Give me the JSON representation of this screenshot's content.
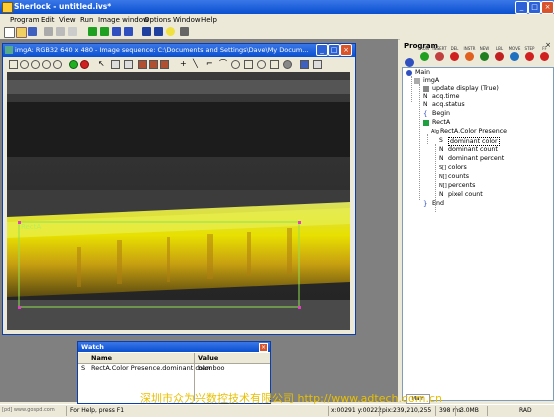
{
  "app": {
    "title": "Sherlock - untitled.ivs*"
  },
  "menu": [
    "Program",
    "Edit",
    "View",
    "Run",
    "Image window",
    "Options",
    "Window",
    "Help"
  ],
  "image_window": {
    "title": "imgA: RGB32 640 x 480 - Image sequence: C:\\Documents and Settings\\Dave\\My Docum...",
    "roi_label": "RectA"
  },
  "watch": {
    "title": "Watch",
    "columns": [
      "Name",
      "Value"
    ],
    "rows": [
      {
        "type": "S",
        "name": "RectA.Color Presence.dominant color",
        "value": "bamboo"
      }
    ]
  },
  "program_panel": {
    "title": "Program",
    "tools": [
      "",
      "RUN",
      "INSERT",
      "DEL",
      "INSTR",
      "NEW",
      "LBL",
      "MOVE",
      "STEP",
      "FF"
    ],
    "tree": [
      {
        "label": "Main",
        "level": 0,
        "icon": "main-icon"
      },
      {
        "label": "imgA",
        "level": 1,
        "icon": "image-icon"
      },
      {
        "label": "update display (True)",
        "level": 2,
        "icon": "instruction-icon"
      },
      {
        "label": "acq.time",
        "level": 2,
        "icon": "numeric-var-icon"
      },
      {
        "label": "acq.status",
        "level": 2,
        "icon": "numeric-var-icon"
      },
      {
        "label": "Begin",
        "level": 2,
        "icon": "begin-icon"
      },
      {
        "label": "RectA",
        "level": 2,
        "icon": "rect-roi-icon"
      },
      {
        "label": "RectA.Color Presence",
        "level": 3,
        "icon": "algorithm-icon"
      },
      {
        "label": "dominant color",
        "level": 4,
        "icon": "string-var-icon",
        "selected": true
      },
      {
        "label": "dominant count",
        "level": 4,
        "icon": "numeric-var-icon"
      },
      {
        "label": "dominant percent",
        "level": 4,
        "icon": "numeric-var-icon"
      },
      {
        "label": "colors",
        "level": 4,
        "icon": "string-array-icon"
      },
      {
        "label": "counts",
        "level": 4,
        "icon": "numeric-array-icon"
      },
      {
        "label": "percents",
        "level": 4,
        "icon": "numeric-array-icon"
      },
      {
        "label": "pixel count",
        "level": 4,
        "icon": "numeric-var-icon"
      },
      {
        "label": "End",
        "level": 2,
        "icon": "end-icon"
      }
    ],
    "tab": "Main"
  },
  "watermark": "深圳市众为兴数控技术有限公司 http://www.adtech.com.cn",
  "site_text": "[pd] www.gospd.com",
  "status": {
    "help": "For Help, press F1",
    "coords": "x:00291 y:00222",
    "pixel": "pix:239,210,255",
    "time": "398 ms",
    "memory": "3.0MB",
    "mode": "RAD"
  },
  "colors": {
    "title": "#0a4fcf",
    "roi": "#c0e060",
    "handle": "#e040c0",
    "tree_selected": "#3169c6"
  }
}
